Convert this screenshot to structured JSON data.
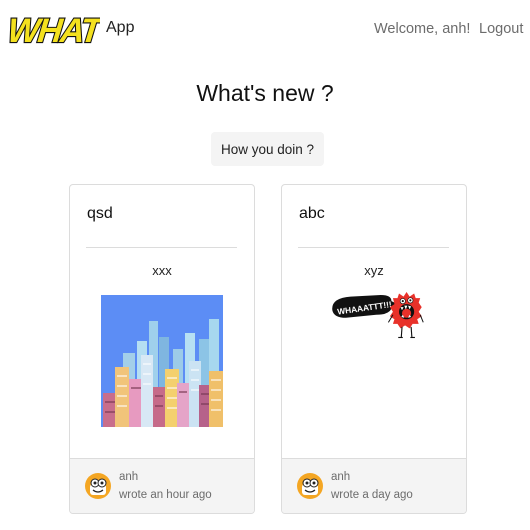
{
  "navbar": {
    "logo_text": "WHAT?",
    "brand": "App",
    "welcome": "Welcome, anh!",
    "logout": "Logout"
  },
  "headline": "What's new ?",
  "post_button": "How you doin ?",
  "posts": [
    {
      "title": "qsd",
      "text": "xxx",
      "image": "city-skyline-pixel-art",
      "author": "anh",
      "time": "wrote an hour ago"
    },
    {
      "title": "abc",
      "text": "xyz",
      "image": "red-monster-shouting-whaaat",
      "image_text": "WHAAATTT!!!",
      "author": "anh",
      "time": "wrote a day ago"
    }
  ],
  "colors": {
    "logo_yellow": "#f4e11e",
    "muted_text": "#6c6c6c",
    "footer_bg": "#f4f4f4",
    "button_bg": "#f4f4f4",
    "sky_blue": "#5c8df5",
    "monster_red": "#e8312a",
    "avatar_orange": "#f4a623"
  }
}
